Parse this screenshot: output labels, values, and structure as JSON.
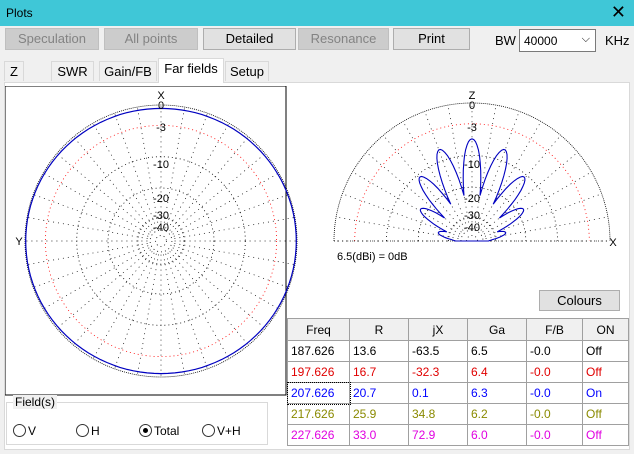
{
  "window": {
    "title": "Plots"
  },
  "toolbar": {
    "speculation": "Speculation",
    "all_points": "All points",
    "detailed": "Detailed",
    "resonance": "Resonance",
    "print": "Print",
    "bw_label": "BW",
    "bw_value": "40000",
    "khz": "KHz"
  },
  "tabs": [
    "Z",
    "SWR",
    "Gain/FB",
    "Far fields",
    "Setup"
  ],
  "active_tab": "Far fields",
  "plots": {
    "left_x": "X",
    "left_y": "Y",
    "left_rings": [
      "0",
      "-3",
      "-10",
      "-20",
      "-30",
      "-40"
    ],
    "right_z": "Z",
    "right_x": "X",
    "right_rings": [
      "0",
      "-3",
      "-10",
      "-20",
      "-30",
      "-40"
    ],
    "zero_ref": "6.5(dBi) = 0dB"
  },
  "colours_button": "Colours",
  "table": {
    "headers": [
      "Freq",
      "R",
      "jX",
      "Ga",
      "F/B",
      "ON"
    ],
    "rows": [
      {
        "color": "#000000",
        "cells": [
          "187.626",
          "13.6",
          "-63.5",
          "6.5",
          "-0.0",
          "Off"
        ]
      },
      {
        "color": "#e00000",
        "cells": [
          "197.626",
          "16.7",
          "-32.3",
          "6.4",
          "-0.0",
          "Off"
        ]
      },
      {
        "color": "#0000ff",
        "cells": [
          "207.626",
          "20.7",
          "0.1",
          "6.3",
          "-0.0",
          "On"
        ]
      },
      {
        "color": "#8a8a00",
        "cells": [
          "217.626",
          "25.9",
          "34.8",
          "6.2",
          "-0.0",
          "Off"
        ]
      },
      {
        "color": "#e000e0",
        "cells": [
          "227.626",
          "33.0",
          "72.9",
          "6.0",
          "-0.0",
          "Off"
        ]
      }
    ]
  },
  "fields": {
    "legend": "Field(s)",
    "options": [
      "V",
      "H",
      "Total",
      "V+H"
    ],
    "selected": "Total"
  },
  "colors": {
    "titlebar": "#3fc7d7",
    "trace": "#0000c0",
    "ref_ring": "#ff0000"
  }
}
